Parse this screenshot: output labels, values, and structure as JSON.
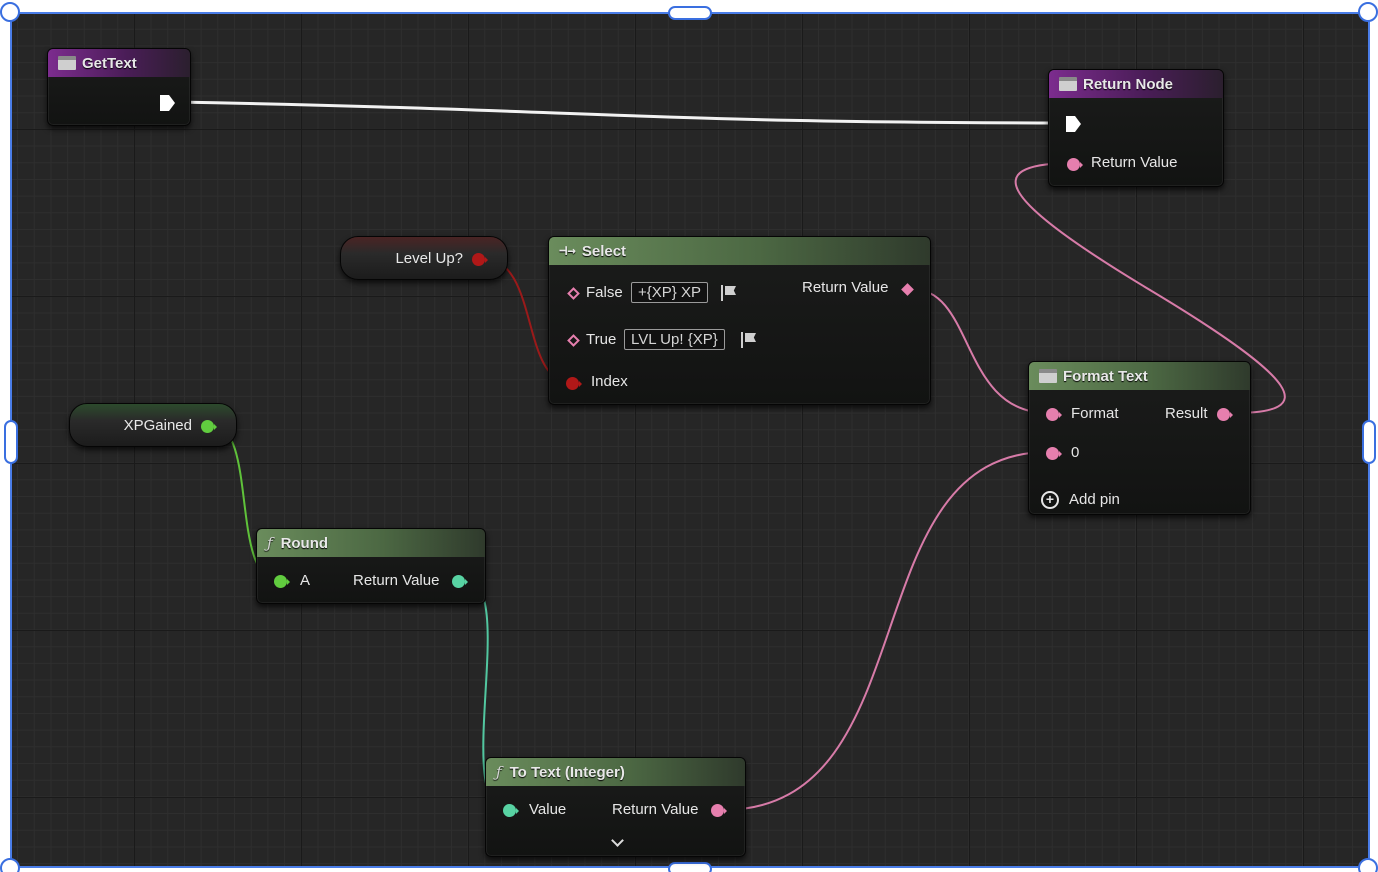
{
  "nodes": {
    "get_text": {
      "title": "GetText"
    },
    "return_node": {
      "title": "Return Node",
      "return_value_pin": "Return Value"
    },
    "level_up": {
      "label": "Level Up?"
    },
    "select": {
      "title": "Select",
      "false_label": "False",
      "false_value": "+{XP} XP",
      "true_label": "True",
      "true_value": "LVL Up! {XP}",
      "index_label": "Index",
      "return_value_label": "Return Value"
    },
    "xp_gained": {
      "label": "XPGained"
    },
    "round": {
      "title": "Round",
      "input_label": "A",
      "return_value_label": "Return Value"
    },
    "format_text": {
      "title": "Format Text",
      "format_label": "Format",
      "result_label": "Result",
      "arg0_label": "0",
      "add_pin_label": "Add pin"
    },
    "to_text": {
      "title": "To Text (Integer)",
      "value_label": "Value",
      "return_value_label": "Return Value"
    }
  },
  "icons": {
    "function": "ƒ",
    "select": "⊣→",
    "add": "+"
  },
  "colors": {
    "frame_border": "#4a7de8",
    "graph_bg": "#262626",
    "header_purple": "#7c2c8e",
    "header_green": "#6a8c5c",
    "pin_text": "#e67fae",
    "pin_float": "#61cc3f",
    "pin_int": "#58d3a3",
    "pin_bool": "#b01818",
    "exec_wire": "#ffffff"
  }
}
